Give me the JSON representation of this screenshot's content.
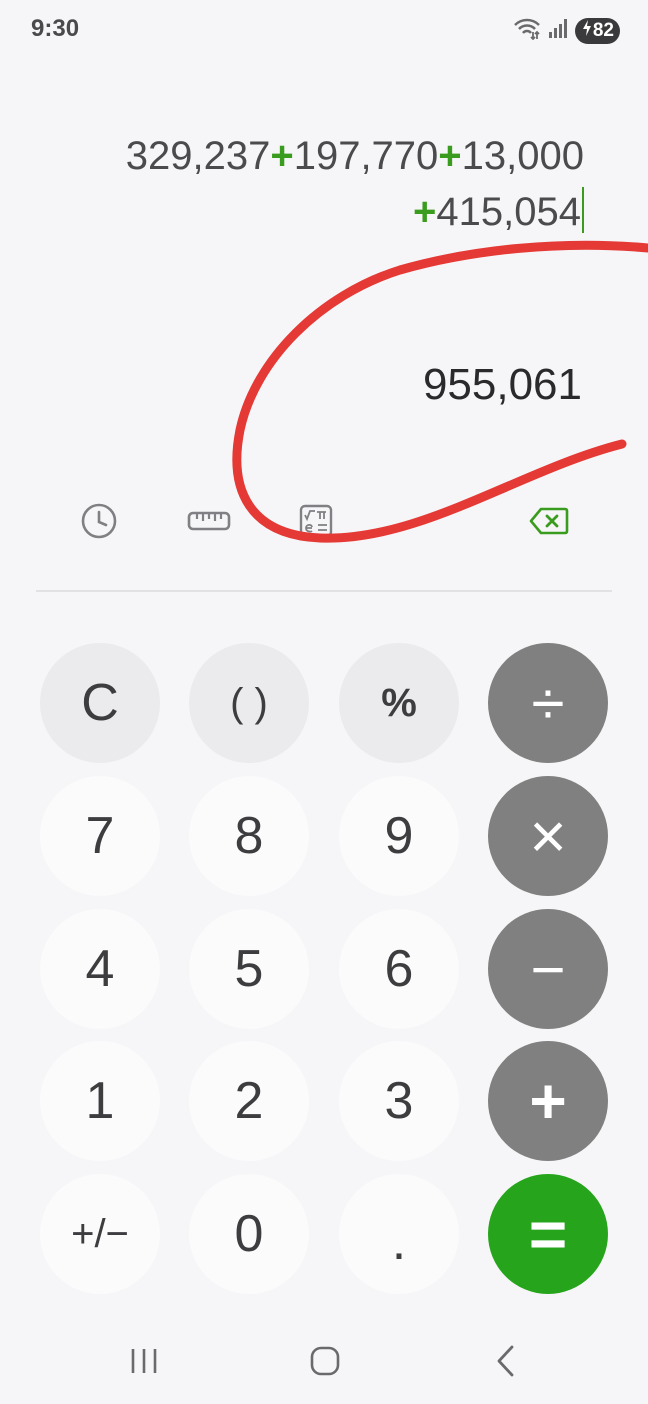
{
  "status_bar": {
    "time": "9:30",
    "battery_level": "82",
    "icons": [
      "wifi-icon",
      "signal-icon",
      "battery-charging-icon"
    ]
  },
  "display": {
    "expression_line1": {
      "n1": "329,237",
      "op1": "+",
      "n2": "197,770",
      "op2": "+",
      "n3": "13,000"
    },
    "expression_line2": {
      "op": "+",
      "n4": "415,054"
    },
    "result": "955,061"
  },
  "toolbar": {
    "icons": [
      "history-icon",
      "unit-converter-ruler-icon",
      "scientific-mode-icon",
      "backspace-icon"
    ]
  },
  "keypad": {
    "clear": "C",
    "parens": "( )",
    "percent": "%",
    "divide": "÷",
    "seven": "7",
    "eight": "8",
    "nine": "9",
    "multiply": "×",
    "four": "4",
    "five": "5",
    "six": "6",
    "minus": "−",
    "one": "1",
    "two": "2",
    "three": "3",
    "plus": "+",
    "plus_minus": "+/−",
    "zero": "0",
    "decimal": ".",
    "equals": "="
  },
  "colors": {
    "accent_green": "#26a51c",
    "operator_green": "#3a9c1e",
    "operator_key_gray": "#808080",
    "annotation_red": "#e53935"
  }
}
